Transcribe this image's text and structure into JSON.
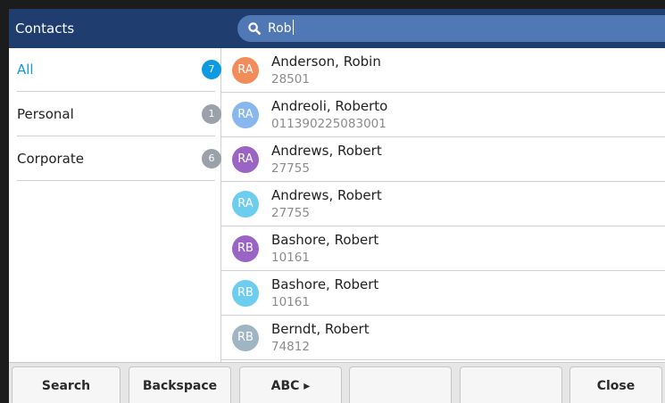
{
  "header": {
    "title": "Contacts"
  },
  "search": {
    "value": "Rob"
  },
  "categories": [
    {
      "label": "All",
      "count": "7",
      "selected": true,
      "color": "#0d9ae0"
    },
    {
      "label": "Personal",
      "count": "1",
      "selected": false,
      "color": "#9aa1aa"
    },
    {
      "label": "Corporate",
      "count": "6",
      "selected": false,
      "color": "#9aa1aa"
    }
  ],
  "contacts": [
    {
      "initials": "RA",
      "name": "Anderson, Robin",
      "number": "28501",
      "color": "#f28c5b"
    },
    {
      "initials": "RA",
      "name": "Andreoli, Roberto",
      "number": "011390225083001",
      "color": "#88b6ee"
    },
    {
      "initials": "RA",
      "name": "Andrews, Robert",
      "number": "27755",
      "color": "#9a64c4"
    },
    {
      "initials": "RA",
      "name": "Andrews, Robert",
      "number": "27755",
      "color": "#6ccdee"
    },
    {
      "initials": "RB",
      "name": "Bashore, Robert",
      "number": "10161",
      "color": "#9a64c4"
    },
    {
      "initials": "RB",
      "name": "Bashore, Robert",
      "number": "10161",
      "color": "#6ccdee"
    },
    {
      "initials": "RB",
      "name": "Berndt, Robert",
      "number": "74812",
      "color": "#9fb5c4"
    }
  ],
  "softkeys": {
    "search": "Search",
    "backspace": "Backspace",
    "abc": "ABC ▸",
    "blank1": "",
    "blank2": "",
    "close": "Close"
  },
  "colors": {
    "header_bg": "#1f3d6f",
    "search_bg": "#4f78b4",
    "selected_text": "#0d9ae0"
  },
  "icons": {
    "search": "search-icon"
  }
}
